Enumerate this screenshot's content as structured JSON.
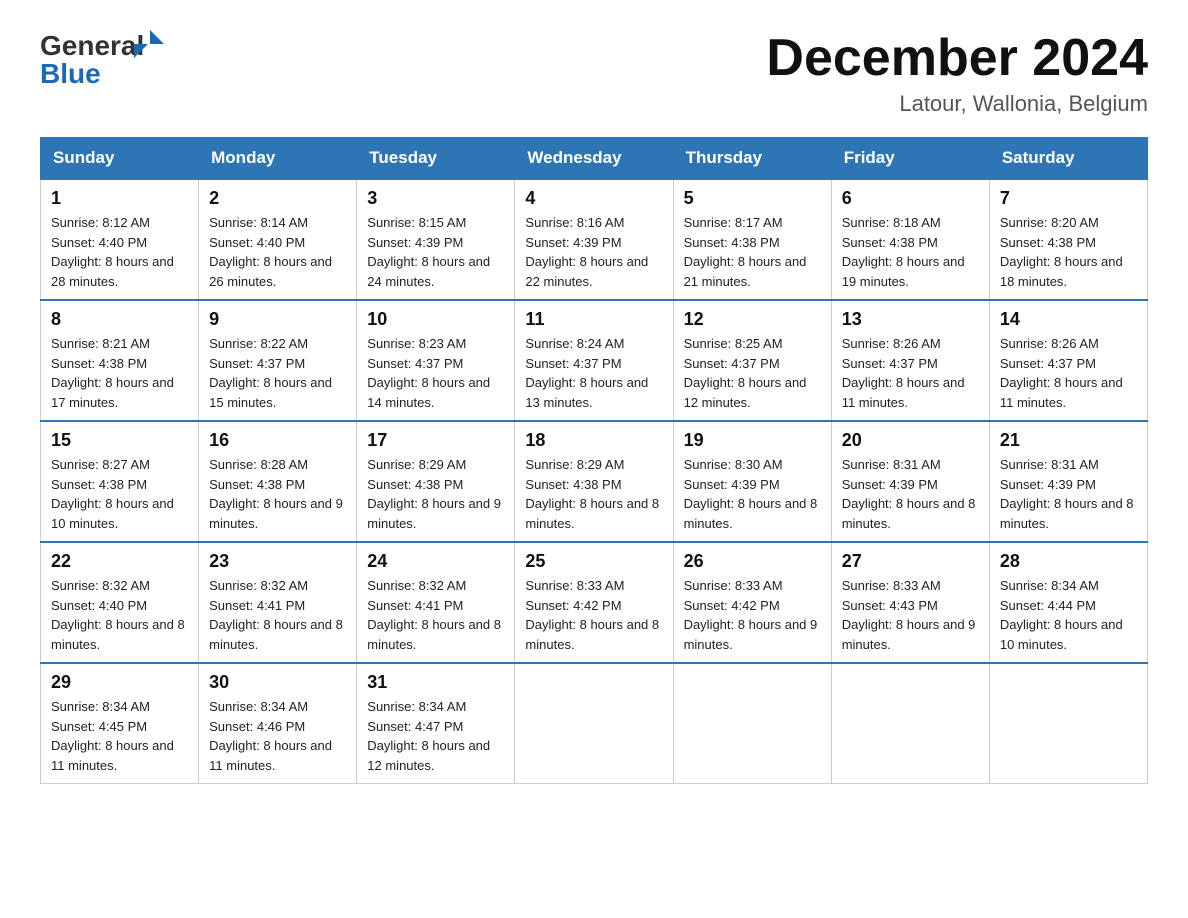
{
  "header": {
    "logo_general": "General",
    "logo_blue": "Blue",
    "month_title": "December 2024",
    "location": "Latour, Wallonia, Belgium"
  },
  "weekdays": [
    "Sunday",
    "Monday",
    "Tuesday",
    "Wednesday",
    "Thursday",
    "Friday",
    "Saturday"
  ],
  "weeks": [
    [
      {
        "day": "1",
        "sunrise": "8:12 AM",
        "sunset": "4:40 PM",
        "daylight": "8 hours and 28 minutes."
      },
      {
        "day": "2",
        "sunrise": "8:14 AM",
        "sunset": "4:40 PM",
        "daylight": "8 hours and 26 minutes."
      },
      {
        "day": "3",
        "sunrise": "8:15 AM",
        "sunset": "4:39 PM",
        "daylight": "8 hours and 24 minutes."
      },
      {
        "day": "4",
        "sunrise": "8:16 AM",
        "sunset": "4:39 PM",
        "daylight": "8 hours and 22 minutes."
      },
      {
        "day": "5",
        "sunrise": "8:17 AM",
        "sunset": "4:38 PM",
        "daylight": "8 hours and 21 minutes."
      },
      {
        "day": "6",
        "sunrise": "8:18 AM",
        "sunset": "4:38 PM",
        "daylight": "8 hours and 19 minutes."
      },
      {
        "day": "7",
        "sunrise": "8:20 AM",
        "sunset": "4:38 PM",
        "daylight": "8 hours and 18 minutes."
      }
    ],
    [
      {
        "day": "8",
        "sunrise": "8:21 AM",
        "sunset": "4:38 PM",
        "daylight": "8 hours and 17 minutes."
      },
      {
        "day": "9",
        "sunrise": "8:22 AM",
        "sunset": "4:37 PM",
        "daylight": "8 hours and 15 minutes."
      },
      {
        "day": "10",
        "sunrise": "8:23 AM",
        "sunset": "4:37 PM",
        "daylight": "8 hours and 14 minutes."
      },
      {
        "day": "11",
        "sunrise": "8:24 AM",
        "sunset": "4:37 PM",
        "daylight": "8 hours and 13 minutes."
      },
      {
        "day": "12",
        "sunrise": "8:25 AM",
        "sunset": "4:37 PM",
        "daylight": "8 hours and 12 minutes."
      },
      {
        "day": "13",
        "sunrise": "8:26 AM",
        "sunset": "4:37 PM",
        "daylight": "8 hours and 11 minutes."
      },
      {
        "day": "14",
        "sunrise": "8:26 AM",
        "sunset": "4:37 PM",
        "daylight": "8 hours and 11 minutes."
      }
    ],
    [
      {
        "day": "15",
        "sunrise": "8:27 AM",
        "sunset": "4:38 PM",
        "daylight": "8 hours and 10 minutes."
      },
      {
        "day": "16",
        "sunrise": "8:28 AM",
        "sunset": "4:38 PM",
        "daylight": "8 hours and 9 minutes."
      },
      {
        "day": "17",
        "sunrise": "8:29 AM",
        "sunset": "4:38 PM",
        "daylight": "8 hours and 9 minutes."
      },
      {
        "day": "18",
        "sunrise": "8:29 AM",
        "sunset": "4:38 PM",
        "daylight": "8 hours and 8 minutes."
      },
      {
        "day": "19",
        "sunrise": "8:30 AM",
        "sunset": "4:39 PM",
        "daylight": "8 hours and 8 minutes."
      },
      {
        "day": "20",
        "sunrise": "8:31 AM",
        "sunset": "4:39 PM",
        "daylight": "8 hours and 8 minutes."
      },
      {
        "day": "21",
        "sunrise": "8:31 AM",
        "sunset": "4:39 PM",
        "daylight": "8 hours and 8 minutes."
      }
    ],
    [
      {
        "day": "22",
        "sunrise": "8:32 AM",
        "sunset": "4:40 PM",
        "daylight": "8 hours and 8 minutes."
      },
      {
        "day": "23",
        "sunrise": "8:32 AM",
        "sunset": "4:41 PM",
        "daylight": "8 hours and 8 minutes."
      },
      {
        "day": "24",
        "sunrise": "8:32 AM",
        "sunset": "4:41 PM",
        "daylight": "8 hours and 8 minutes."
      },
      {
        "day": "25",
        "sunrise": "8:33 AM",
        "sunset": "4:42 PM",
        "daylight": "8 hours and 8 minutes."
      },
      {
        "day": "26",
        "sunrise": "8:33 AM",
        "sunset": "4:42 PM",
        "daylight": "8 hours and 9 minutes."
      },
      {
        "day": "27",
        "sunrise": "8:33 AM",
        "sunset": "4:43 PM",
        "daylight": "8 hours and 9 minutes."
      },
      {
        "day": "28",
        "sunrise": "8:34 AM",
        "sunset": "4:44 PM",
        "daylight": "8 hours and 10 minutes."
      }
    ],
    [
      {
        "day": "29",
        "sunrise": "8:34 AM",
        "sunset": "4:45 PM",
        "daylight": "8 hours and 11 minutes."
      },
      {
        "day": "30",
        "sunrise": "8:34 AM",
        "sunset": "4:46 PM",
        "daylight": "8 hours and 11 minutes."
      },
      {
        "day": "31",
        "sunrise": "8:34 AM",
        "sunset": "4:47 PM",
        "daylight": "8 hours and 12 minutes."
      },
      null,
      null,
      null,
      null
    ]
  ],
  "labels": {
    "sunrise": "Sunrise:",
    "sunset": "Sunset:",
    "daylight": "Daylight:"
  }
}
